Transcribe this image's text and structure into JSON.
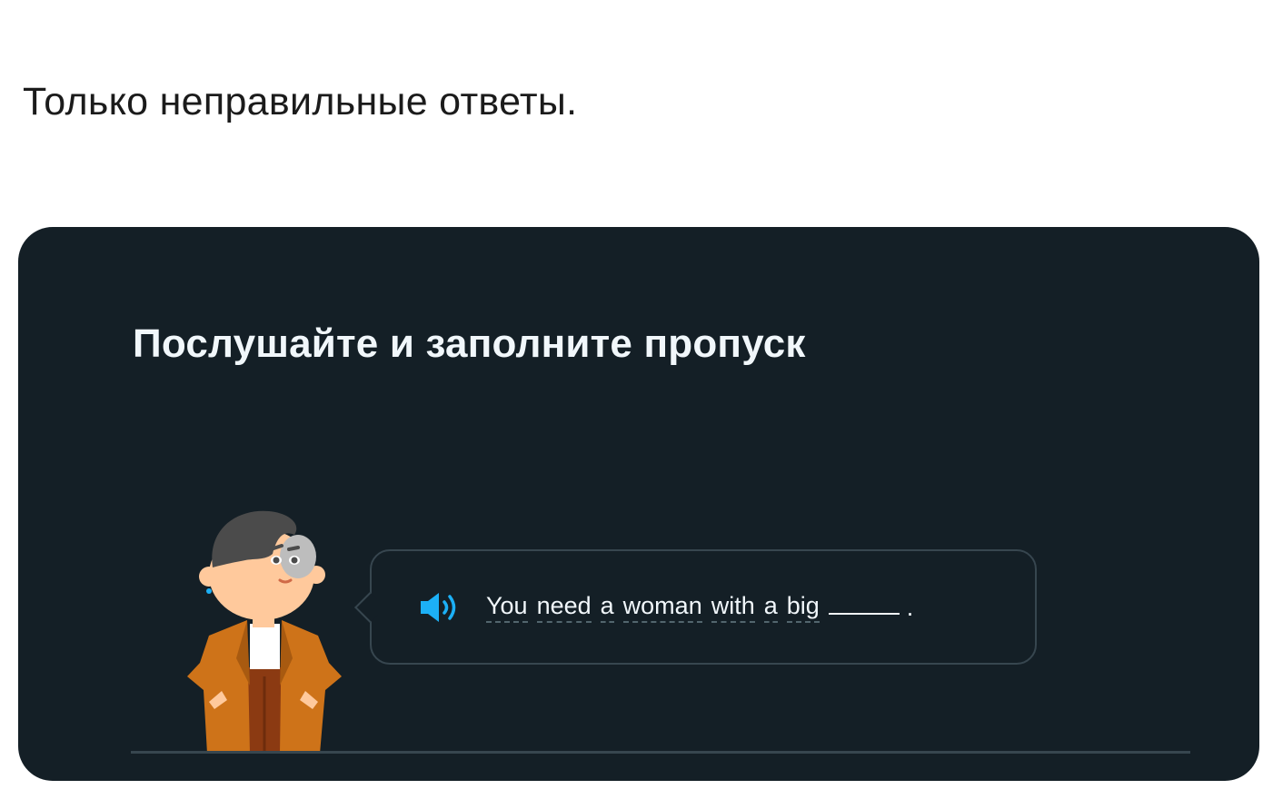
{
  "post": {
    "caption": "Только неправильные ответы."
  },
  "exercise": {
    "instruction": "Послушайте и заполните пропуск",
    "speaker_icon": "speaker-icon",
    "words": [
      "You",
      "need",
      "a",
      "woman",
      "with",
      "a",
      "big"
    ],
    "blank_value": "",
    "period": "."
  },
  "colors": {
    "card_background": "#141f26",
    "border": "#37464f",
    "text": "#f1f7fb",
    "speaker_accent": "#1cb0f6",
    "character_jacket": "#ce7319",
    "character_hair": "#4b4b4b",
    "character_skin": "#ffc99c"
  }
}
